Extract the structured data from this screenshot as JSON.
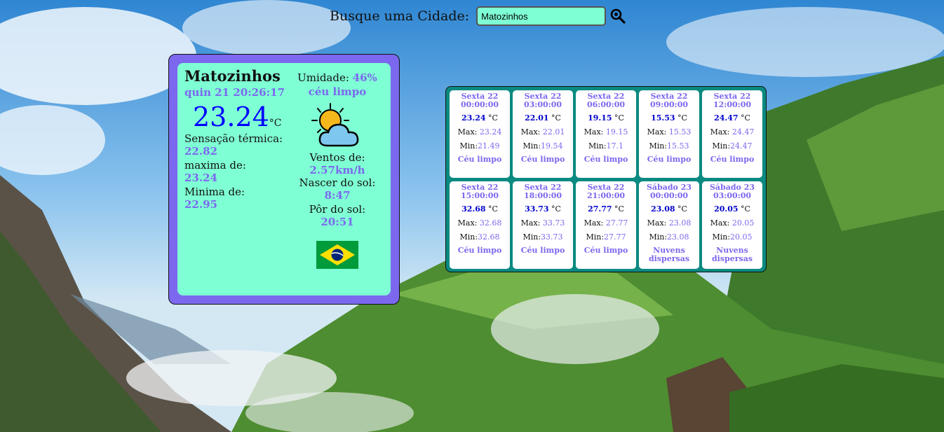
{
  "search": {
    "label": "Busque uma Cidade:",
    "value": "Matozinhos"
  },
  "current": {
    "city": "Matozinhos",
    "datetime": "quin 21 20:26:17",
    "temperature": "23.24",
    "unit": "°C",
    "feels_like_label": "Sensação térmica:",
    "feels_like": "22.82",
    "max_label": "maxima de:",
    "max": "23.24",
    "min_label": "Minima de:",
    "min": "22.95",
    "humidity_label": "Umidade:",
    "humidity": "46%",
    "description": "céu limpo",
    "icon": "partly-cloudy-sun-icon",
    "wind_label": "Ventos de:",
    "wind": "2.57km/h",
    "sunrise_label": "Nascer do sol:",
    "sunrise": "8:47",
    "sunset_label": "Pôr do sol:",
    "sunset": "20:51",
    "flag": "brazil-flag-icon"
  },
  "forecast": [
    {
      "day": "Sexta 22",
      "time": "00:00:00",
      "temp": "23.24",
      "unit": "°C",
      "max_label": "Max:",
      "max": "23.24",
      "min_label": "Min:",
      "min": "21.49",
      "desc": "Céu limpo"
    },
    {
      "day": "Sexta 22",
      "time": "03:00:00",
      "temp": "22.01",
      "unit": "°C",
      "max_label": "Max:",
      "max": "22.01",
      "min_label": "Min:",
      "min": "19.54",
      "desc": "Céu limpo"
    },
    {
      "day": "Sexta 22",
      "time": "06:00:00",
      "temp": "19.15",
      "unit": "°C",
      "max_label": "Max:",
      "max": "19.15",
      "min_label": "Min:",
      "min": "17.1",
      "desc": "Céu limpo"
    },
    {
      "day": "Sexta 22",
      "time": "09:00:00",
      "temp": "15.53",
      "unit": "°C",
      "max_label": "Max:",
      "max": "15.53",
      "min_label": "Min:",
      "min": "15.53",
      "desc": "Céu limpo"
    },
    {
      "day": "Sexta 22",
      "time": "12:00:00",
      "temp": "24.47",
      "unit": "°C",
      "max_label": "Max:",
      "max": "24.47",
      "min_label": "Min:",
      "min": "24.47",
      "desc": "Céu limpo"
    },
    {
      "day": "Sexta 22",
      "time": "15:00:00",
      "temp": "32.68",
      "unit": "°C",
      "max_label": "Max:",
      "max": "32.68",
      "min_label": "Min:",
      "min": "32.68",
      "desc": "Céu limpo"
    },
    {
      "day": "Sexta 22",
      "time": "18:00:00",
      "temp": "33.73",
      "unit": "°C",
      "max_label": "Max:",
      "max": "33.73",
      "min_label": "Min:",
      "min": "33.73",
      "desc": "Céu limpo"
    },
    {
      "day": "Sexta 22",
      "time": "21:00:00",
      "temp": "27.77",
      "unit": "°C",
      "max_label": "Max:",
      "max": "27.77",
      "min_label": "Min:",
      "min": "27.77",
      "desc": "Céu limpo"
    },
    {
      "day": "Sábado 23",
      "time": "00:00:00",
      "temp": "23.08",
      "unit": "°C",
      "max_label": "Max:",
      "max": "23.08",
      "min_label": "Min:",
      "min": "23.08",
      "desc": "Nuvens dispersas"
    },
    {
      "day": "Sábado 23",
      "time": "03:00:00",
      "temp": "20.05",
      "unit": "°C",
      "max_label": "Max:",
      "max": "20.05",
      "min_label": "Min:",
      "min": "20.05",
      "desc": "Nuvens dispersas"
    }
  ],
  "colors": {
    "accent": "#7b68ee",
    "panel": "#7fffd4",
    "forecast_frame": "#0a8a80",
    "temp_blue": "#0000ff"
  }
}
